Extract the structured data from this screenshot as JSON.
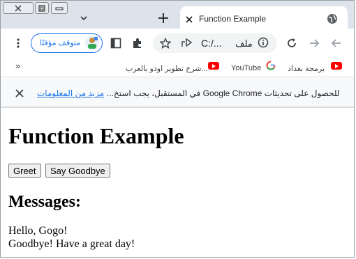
{
  "browser": {
    "tab": {
      "title": "Function Example"
    },
    "profile": {
      "label": "متوقف مؤقتًا"
    },
    "address": {
      "prefix": "ملف",
      "url": "C:/..."
    },
    "bookmarks": [
      {
        "label": "برمجة بغداد",
        "icon": "youtube-icon"
      },
      {
        "label": "YouTube",
        "icon": "google-icon"
      },
      {
        "label": "شرح تطوير اودو بالعرب...",
        "icon": "youtube-icon"
      }
    ],
    "bookmarks_overflow": "»",
    "infobar": {
      "message": "للحصول على تحديثات Google Chrome في المستقبل، يجب استخ...",
      "link": "مزيد من المعلومات"
    },
    "colors": {
      "tabstrip": "#dde3ea",
      "accent": "#1a73e8",
      "youtube": "#ff0000"
    }
  },
  "page": {
    "heading": "Function Example",
    "buttons": {
      "greet": "Greet",
      "goodbye": "Say Goodbye"
    },
    "messages_heading": "Messages:",
    "messages": [
      "Hello, Gogo!",
      "Goodbye! Have a great day!"
    ]
  }
}
